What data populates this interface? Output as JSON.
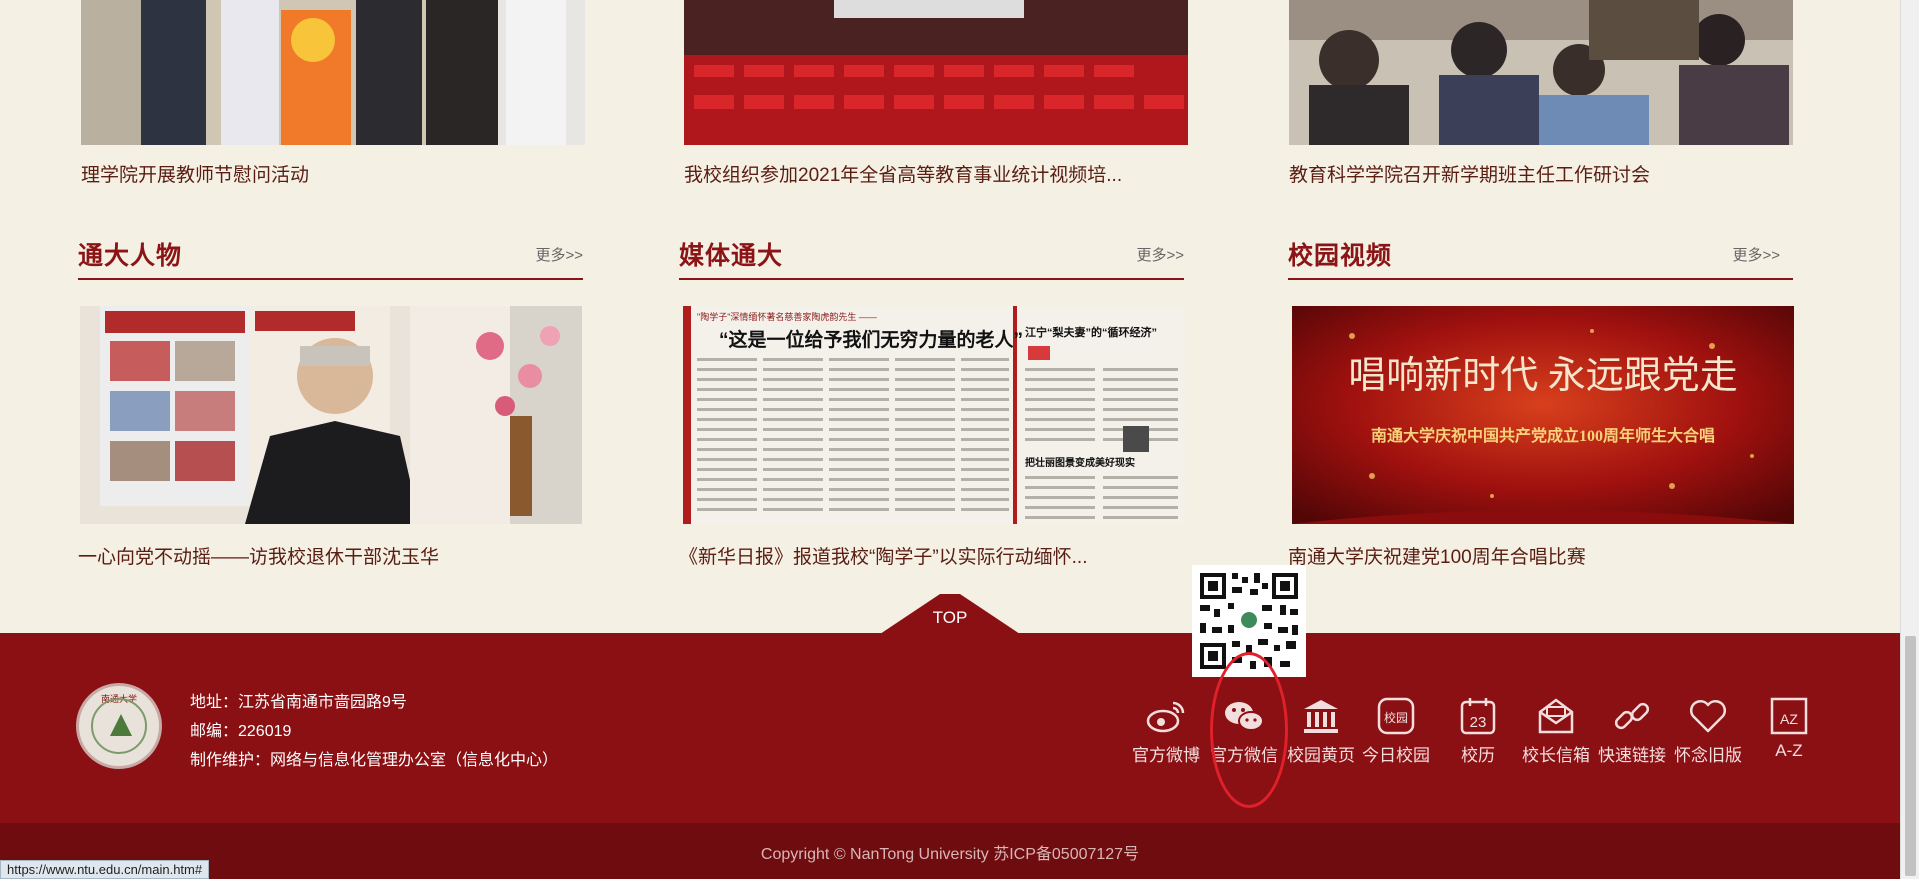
{
  "top_news": [
    {
      "title": "理学院开展教师节慰问活动"
    },
    {
      "title": "我校组织参加2021年全省高等教育事业统计视频培..."
    },
    {
      "title": "教育科学学院召开新学期班主任工作研讨会"
    }
  ],
  "sections": [
    {
      "title": "通大人物",
      "more": "更多>>",
      "caption": "一心向党不动摇——访我校退休干部沈玉华"
    },
    {
      "title": "媒体通大",
      "more": "更多>>",
      "caption": "《新华日报》报道我校“陶学子”以实际行动缅怀..."
    },
    {
      "title": "校园视频",
      "more": "更多>>",
      "caption": "南通大学庆祝建党100周年合唱比赛"
    }
  ],
  "media_image": {
    "headline_top": "\"陶学子\"深情缅怀著名慈善家陶虎韵先生 ——",
    "headline_main": "“这是一位给予我们无穷力量的老人”",
    "side_headline": "江宁“梨夫妻”的“循环经济”",
    "sub_headline": "把壮丽图景变成美好现实"
  },
  "video_image": {
    "title_main": "唱响新时代 永远跟党走",
    "title_sub": "南通大学庆祝中国共产党成立100周年师生大合唱"
  },
  "footer": {
    "top_label": "TOP",
    "logo_text": "南通大学",
    "address": "地址：江苏省南通市啬园路9号",
    "postcode": "邮编：226019",
    "maintainer": "制作维护：网络与信息化管理办公室（信息化中心）",
    "links": [
      {
        "label": "官方微博",
        "icon": "weibo-icon"
      },
      {
        "label": "官方微信",
        "icon": "wechat-icon"
      },
      {
        "label": "校园黄页",
        "icon": "building-icon"
      },
      {
        "label": "今日校园",
        "icon": "campus-app-icon"
      },
      {
        "label": "校历",
        "icon": "calendar-icon"
      },
      {
        "label": "校长信箱",
        "icon": "mail-icon"
      },
      {
        "label": "快速链接",
        "icon": "link-icon"
      },
      {
        "label": "怀念旧版",
        "icon": "heart-icon"
      },
      {
        "label": "A-Z",
        "icon": "az-icon"
      }
    ],
    "calendar_day": "23",
    "az_glyph": "AZ",
    "campus_glyph": "校园",
    "copyright": "Copyright © NanTong University 苏ICP备05007127号"
  },
  "status_url": "https://www.ntu.edu.cn/main.htm#",
  "colors": {
    "brand_red": "#8b1014",
    "highlight_circle": "#e0202a",
    "background": "#f5f0e4"
  }
}
